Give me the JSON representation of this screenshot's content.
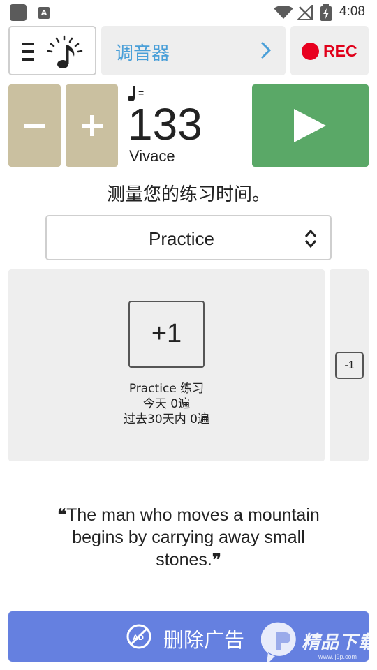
{
  "status_bar": {
    "time": "4:08",
    "app_badge": "A"
  },
  "toolbar": {
    "tuner_label": "调音器",
    "rec_label": "REC"
  },
  "tempo": {
    "bpm": "133",
    "name": "Vivace",
    "note_equals": "="
  },
  "practice": {
    "heading": "测量您的练习时间。",
    "selected": "Practice",
    "plus_one": "+1",
    "minus_one": "-1",
    "info_lines": [
      "Practice 练习",
      "今天 0遍",
      "过去30天内 0遍"
    ]
  },
  "quote": {
    "open_mark": "❝",
    "text": "The man who moves a mountain begins by carrying away small stones.",
    "close_mark": "❞"
  },
  "ads": {
    "label": "删除广告",
    "icon_text": "AD"
  },
  "watermark": {
    "text": "精品下载",
    "sub": "www.jj9p.com"
  },
  "colors": {
    "accent_blue": "#4a9fd8",
    "rec_red": "#e8001f",
    "tempo_button": "#cac0a0",
    "play_green": "#5aa867",
    "ads_blue": "#6580e0",
    "panel_gray": "#eeeeee"
  }
}
